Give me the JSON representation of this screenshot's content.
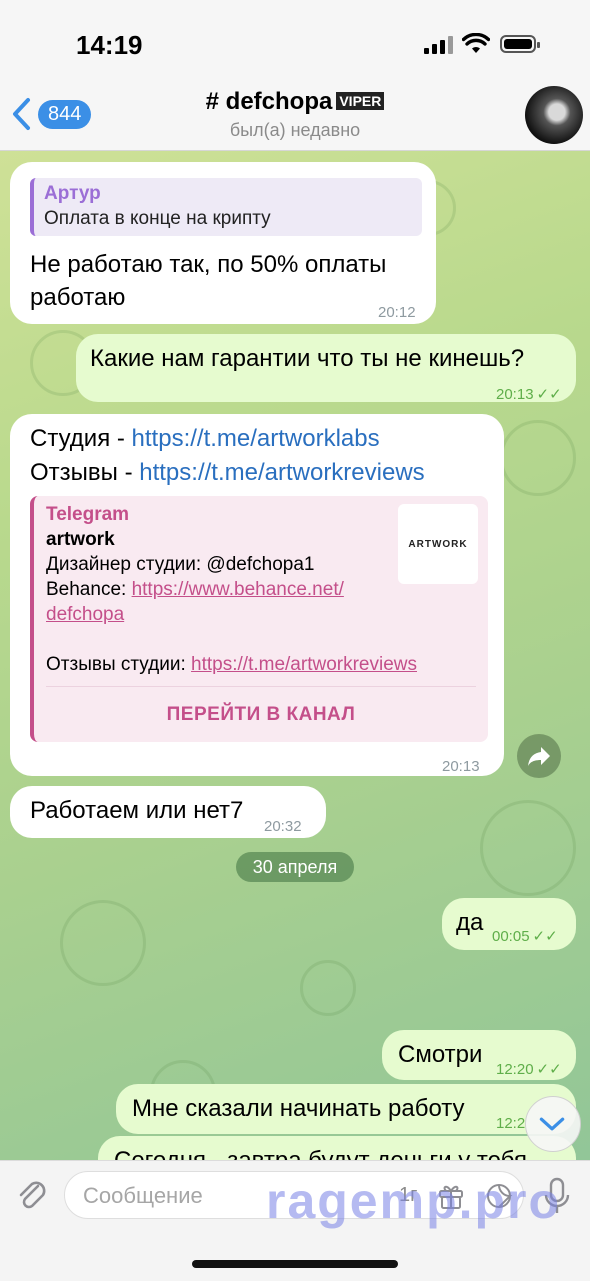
{
  "status_bar": {
    "time": "14:19"
  },
  "header": {
    "back_count": "844",
    "title": "# defchopa",
    "title_tag": "VIPER",
    "subtitle": "был(а) недавно"
  },
  "messages": {
    "m1": {
      "reply_name": "Артур",
      "reply_text": "Оплата в конце на крипту",
      "text_line1": "Не работаю так, по 50% оплаты",
      "text_line2": "работаю",
      "time": "20:12"
    },
    "m2": {
      "text": "Какие нам гарантии что ты не кинешь?",
      "time": "20:13"
    },
    "m3": {
      "line1_label": "Студия - ",
      "line1_link": "https://t.me/artworklabs",
      "line2_label": "Отзывы - ",
      "line2_link": "https://t.me/artworkreviews",
      "preview_site": "Telegram",
      "preview_title": "artwork",
      "preview_line1": "Дизайнер студии: @defchopa1",
      "preview_line2_label": "Behance: ",
      "preview_line2_link_a": "https://www.behance.net/",
      "preview_line2_link_b": "defchopa",
      "preview_line3_label": "Отзывы студии: ",
      "preview_line3_link": "https://t.me/artworkreviews",
      "preview_image_text": "ARTWORK",
      "preview_button": "ПЕРЕЙТИ В КАНАЛ",
      "time": "20:13"
    },
    "m4": {
      "text": "Работаем или нет7",
      "time": "20:32"
    },
    "date_separator": "30 апреля",
    "m5": {
      "text": "да",
      "time": "00:05"
    },
    "m6": {
      "text": "Смотри",
      "time": "12:20"
    },
    "m7": {
      "text": "Мне сказали начинать работу",
      "time": "12:2"
    },
    "m8": {
      "text": "Сегодня - завтра будут деньги у тебя"
    }
  },
  "input_bar": {
    "placeholder": "Сообщение",
    "command_label": "1г"
  },
  "watermark": "ragemp.pro",
  "colors": {
    "accent": "#3b8fe6",
    "incoming_bubble": "#ffffff",
    "outgoing_bubble": "#e6fbcf",
    "reply_accent": "#9b6ed6",
    "preview_accent": "#c44f8a",
    "link": "#2a6fbf"
  }
}
